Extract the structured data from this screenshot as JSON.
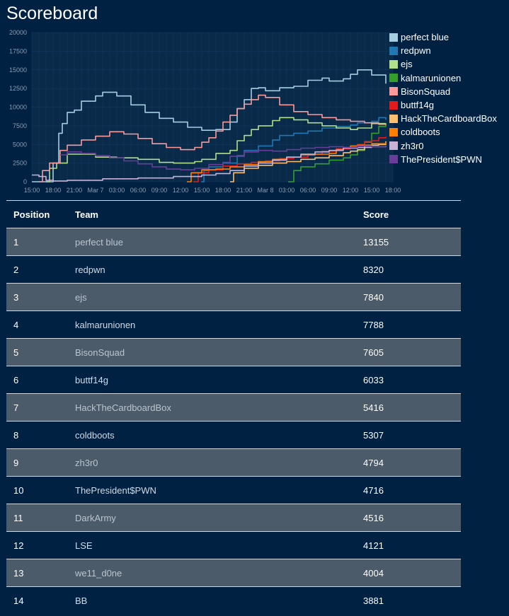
{
  "page": {
    "title": "Scoreboard"
  },
  "chart_data": {
    "type": "line",
    "xlabel": "",
    "ylabel": "",
    "x_ticks": [
      "15:00",
      "18:00",
      "21:00",
      "Mar 7",
      "03:00",
      "06:00",
      "09:00",
      "12:00",
      "15:00",
      "18:00",
      "21:00",
      "Mar 8",
      "03:00",
      "06:00",
      "09:00",
      "12:00",
      "15:00",
      "18:00"
    ],
    "x_range_hours": [
      0,
      51
    ],
    "ylim": [
      0,
      20000
    ],
    "y_ticks": [
      "0",
      "2500",
      "5000",
      "7500",
      "10000",
      "12500",
      "15000",
      "17500",
      "20000"
    ],
    "grid": true,
    "legend": "top-right",
    "series": [
      {
        "name": "perfect blue",
        "color": "#a6cee3",
        "points": [
          [
            0,
            0
          ],
          [
            2,
            0
          ],
          [
            3,
            2500
          ],
          [
            3.8,
            6500
          ],
          [
            4.3,
            7800
          ],
          [
            5,
            9300
          ],
          [
            6,
            9600
          ],
          [
            7,
            10800
          ],
          [
            9,
            11500
          ],
          [
            10,
            12000
          ],
          [
            12,
            11500
          ],
          [
            14,
            10300
          ],
          [
            16,
            9300
          ],
          [
            18,
            8500
          ],
          [
            20,
            8000
          ],
          [
            22,
            7300
          ],
          [
            24,
            6900
          ],
          [
            26,
            7000
          ],
          [
            28,
            8000
          ],
          [
            29,
            9800
          ],
          [
            30,
            11000
          ],
          [
            31,
            12500
          ],
          [
            32,
            12600
          ],
          [
            33,
            12200
          ],
          [
            35,
            12600
          ],
          [
            37,
            12800
          ],
          [
            39,
            13600
          ],
          [
            41,
            13900
          ],
          [
            42,
            13500
          ],
          [
            44,
            13800
          ],
          [
            45,
            14400
          ],
          [
            46,
            15000
          ],
          [
            48,
            14300
          ],
          [
            50,
            13155
          ]
        ]
      },
      {
        "name": "redpwn",
        "color": "#1f78b4",
        "points": [
          [
            23.9,
            0
          ],
          [
            24.3,
            1500
          ],
          [
            25,
            2000
          ],
          [
            27,
            2500
          ],
          [
            29,
            3500
          ],
          [
            30,
            4200
          ],
          [
            32,
            4800
          ],
          [
            34,
            5600
          ],
          [
            35,
            6200
          ],
          [
            37,
            6500
          ],
          [
            39,
            6800
          ],
          [
            41,
            7200
          ],
          [
            43,
            7400
          ],
          [
            45,
            7600
          ],
          [
            46,
            7900
          ],
          [
            48,
            8100
          ],
          [
            49,
            8600
          ],
          [
            50,
            8320
          ]
        ]
      },
      {
        "name": "ejs",
        "color": "#b2df8a",
        "points": [
          [
            2,
            0
          ],
          [
            2.5,
            1800
          ],
          [
            3.5,
            2500
          ],
          [
            5,
            3700
          ],
          [
            9,
            3300
          ],
          [
            12,
            3200
          ],
          [
            15,
            3000
          ],
          [
            18,
            2600
          ],
          [
            20,
            2500
          ],
          [
            23,
            2700
          ],
          [
            24,
            3000
          ],
          [
            26,
            3800
          ],
          [
            28,
            4200
          ],
          [
            29,
            5500
          ],
          [
            30,
            6200
          ],
          [
            31,
            7000
          ],
          [
            32,
            7500
          ],
          [
            34,
            8200
          ],
          [
            35,
            8600
          ],
          [
            37,
            8300
          ],
          [
            39,
            7900
          ],
          [
            41,
            7500
          ],
          [
            43,
            7200
          ],
          [
            45,
            7000
          ],
          [
            46,
            7200
          ],
          [
            48,
            7800
          ],
          [
            50,
            7840
          ]
        ]
      },
      {
        "name": "kalmarunionen",
        "color": "#33a02c",
        "points": [
          [
            36.2,
            0
          ],
          [
            37,
            1500
          ],
          [
            38,
            2000
          ],
          [
            40,
            2400
          ],
          [
            42,
            2900
          ],
          [
            44,
            3200
          ],
          [
            45,
            3600
          ],
          [
            46,
            4200
          ],
          [
            47,
            5300
          ],
          [
            48,
            6500
          ],
          [
            49,
            7400
          ],
          [
            50,
            7788
          ]
        ]
      },
      {
        "name": "BisonSquad",
        "color": "#fb9a99",
        "points": [
          [
            1,
            0
          ],
          [
            1.5,
            1500
          ],
          [
            2.5,
            2500
          ],
          [
            4,
            4200
          ],
          [
            5,
            4900
          ],
          [
            7,
            5600
          ],
          [
            9,
            6100
          ],
          [
            11,
            6700
          ],
          [
            13,
            6400
          ],
          [
            15,
            5800
          ],
          [
            17,
            5100
          ],
          [
            19,
            4600
          ],
          [
            21,
            4300
          ],
          [
            23,
            4600
          ],
          [
            24,
            5300
          ],
          [
            25,
            5900
          ],
          [
            26,
            6800
          ],
          [
            27,
            8000
          ],
          [
            28,
            8900
          ],
          [
            29,
            9800
          ],
          [
            30,
            10400
          ],
          [
            31,
            11000
          ],
          [
            32,
            11600
          ],
          [
            33,
            11300
          ],
          [
            35,
            10300
          ],
          [
            37,
            9400
          ],
          [
            39,
            9000
          ],
          [
            41,
            8600
          ],
          [
            43,
            8300
          ],
          [
            45,
            8100
          ],
          [
            47,
            7900
          ],
          [
            49,
            7700
          ],
          [
            50,
            7605
          ]
        ]
      },
      {
        "name": "buttf14g",
        "color": "#e31a1c",
        "points": [
          [
            22.8,
            0
          ],
          [
            23.5,
            1200
          ],
          [
            25,
            1600
          ],
          [
            27,
            2100
          ],
          [
            29,
            2400
          ],
          [
            31,
            2600
          ],
          [
            33,
            2800
          ],
          [
            35,
            3100
          ],
          [
            37,
            3300
          ],
          [
            39,
            3700
          ],
          [
            41,
            4100
          ],
          [
            43,
            4400
          ],
          [
            45,
            4600
          ],
          [
            46,
            5000
          ],
          [
            47,
            5400
          ],
          [
            48,
            5500
          ],
          [
            49,
            5900
          ],
          [
            50,
            6033
          ]
        ]
      },
      {
        "name": "HackTheCardboardBox",
        "color": "#fdbf6f",
        "points": [
          [
            28,
            0
          ],
          [
            28.5,
            1200
          ],
          [
            30,
            1800
          ],
          [
            32,
            2200
          ],
          [
            34,
            2500
          ],
          [
            36,
            2700
          ],
          [
            38,
            3000
          ],
          [
            40,
            3200
          ],
          [
            42,
            3500
          ],
          [
            44,
            3900
          ],
          [
            45,
            4100
          ],
          [
            46,
            4300
          ],
          [
            47,
            4800
          ],
          [
            48,
            4900
          ],
          [
            49,
            5000
          ],
          [
            50,
            5416
          ]
        ]
      },
      {
        "name": "coldboots",
        "color": "#ff7f00",
        "points": [
          [
            21.9,
            0
          ],
          [
            22.5,
            1200
          ],
          [
            24,
            1600
          ],
          [
            26,
            1700
          ],
          [
            28,
            2000
          ],
          [
            30,
            2300
          ],
          [
            32,
            2700
          ],
          [
            34,
            3000
          ],
          [
            36,
            3300
          ],
          [
            38,
            3600
          ],
          [
            40,
            3700
          ],
          [
            42,
            3800
          ],
          [
            43,
            4300
          ],
          [
            44,
            4600
          ],
          [
            45,
            4800
          ],
          [
            46,
            4900
          ],
          [
            48,
            5100
          ],
          [
            50,
            5307
          ]
        ]
      },
      {
        "name": "zh3r0",
        "color": "#cab2d6",
        "points": [
          [
            0,
            900
          ],
          [
            1,
            700
          ],
          [
            2,
            200
          ],
          [
            3,
            100
          ],
          [
            5,
            200
          ],
          [
            10,
            400
          ],
          [
            15,
            500
          ],
          [
            20,
            700
          ],
          [
            24,
            900
          ],
          [
            26,
            1100
          ],
          [
            28,
            1500
          ],
          [
            30,
            2100
          ],
          [
            32,
            2500
          ],
          [
            34,
            2900
          ],
          [
            36,
            3300
          ],
          [
            38,
            3700
          ],
          [
            40,
            4000
          ],
          [
            42,
            4200
          ],
          [
            44,
            4500
          ],
          [
            46,
            4600
          ],
          [
            48,
            4700
          ],
          [
            50,
            4794
          ]
        ]
      },
      {
        "name": "ThePresident$PWN",
        "color": "#6a3d9a",
        "points": [
          [
            4,
            3600
          ],
          [
            5,
            4000
          ],
          [
            7,
            3800
          ],
          [
            9,
            3500
          ],
          [
            11,
            3200
          ],
          [
            13,
            2800
          ],
          [
            15,
            2400
          ],
          [
            17,
            2000
          ],
          [
            19,
            1700
          ],
          [
            21,
            1600
          ],
          [
            23,
            1800
          ],
          [
            25,
            2300
          ],
          [
            27,
            2600
          ],
          [
            28,
            3400
          ],
          [
            30,
            4000
          ],
          [
            32,
            4200
          ],
          [
            34,
            4100
          ],
          [
            36,
            4300
          ],
          [
            38,
            4500
          ],
          [
            40,
            4600
          ],
          [
            42,
            4700
          ],
          [
            44,
            4600
          ],
          [
            46,
            4800
          ],
          [
            48,
            4700
          ],
          [
            50,
            4716
          ]
        ]
      }
    ]
  },
  "table": {
    "headers": {
      "position": "Position",
      "team": "Team",
      "score": "Score"
    },
    "rows": [
      {
        "position": "1",
        "team": "perfect blue",
        "score": "13155"
      },
      {
        "position": "2",
        "team": "redpwn",
        "score": "8320"
      },
      {
        "position": "3",
        "team": "ejs",
        "score": "7840"
      },
      {
        "position": "4",
        "team": "kalmarunionen",
        "score": "7788"
      },
      {
        "position": "5",
        "team": "BisonSquad",
        "score": "7605"
      },
      {
        "position": "6",
        "team": "buttf14g",
        "score": "6033"
      },
      {
        "position": "7",
        "team": "HackTheCardboardBox",
        "score": "5416"
      },
      {
        "position": "8",
        "team": "coldboots",
        "score": "5307"
      },
      {
        "position": "9",
        "team": "zh3r0",
        "score": "4794"
      },
      {
        "position": "10",
        "team": "ThePresident$PWN",
        "score": "4716"
      },
      {
        "position": "11",
        "team": "DarkArmy",
        "score": "4516"
      },
      {
        "position": "12",
        "team": "LSE",
        "score": "4121"
      },
      {
        "position": "13",
        "team": "we11_d0ne",
        "score": "4004"
      },
      {
        "position": "14",
        "team": "BB",
        "score": "3881"
      }
    ]
  }
}
